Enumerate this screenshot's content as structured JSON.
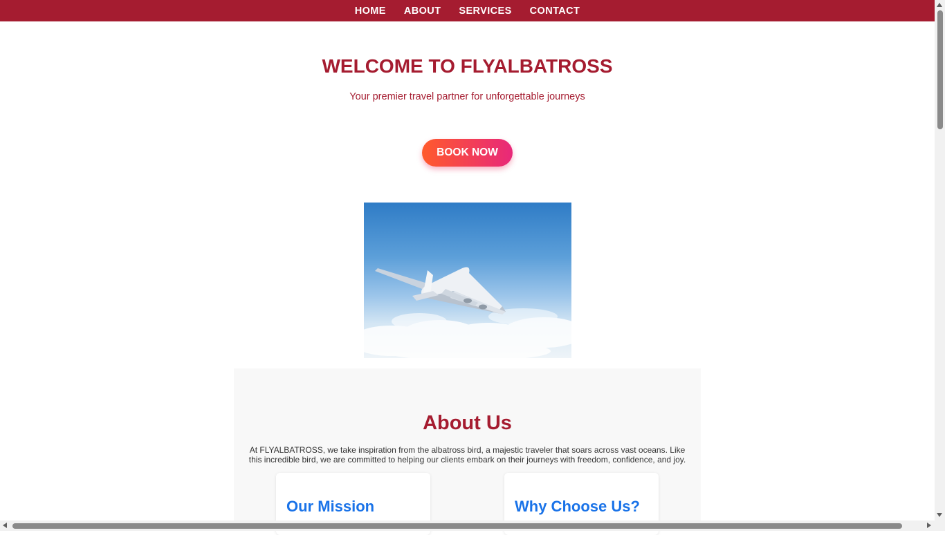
{
  "nav": {
    "items": [
      {
        "label": "HOME"
      },
      {
        "label": "ABOUT"
      },
      {
        "label": "SERVICES"
      },
      {
        "label": "CONTACT"
      }
    ]
  },
  "hero": {
    "title": "WELCOME TO FLYALBATROSS",
    "subtitle": "Your premier travel partner for unforgettable journeys",
    "cta_label": "BOOK NOW",
    "image_icon": "airplane-in-sky"
  },
  "about": {
    "title": "About Us",
    "text": "At FLYALBATROSS, we take inspiration from the albatross bird, a majestic traveler that soars across vast oceans. Like this incredible bird, we are committed to helping our clients embark on their journeys with freedom, confidence, and joy.",
    "cards": [
      {
        "title": "Our Mission"
      },
      {
        "title": "Why Choose Us?"
      }
    ]
  },
  "colors": {
    "brand": "#a51c30",
    "cta_gradient_start": "#ff5a2c",
    "cta_gradient_end": "#e8287a",
    "card_title": "#1a73e8"
  }
}
